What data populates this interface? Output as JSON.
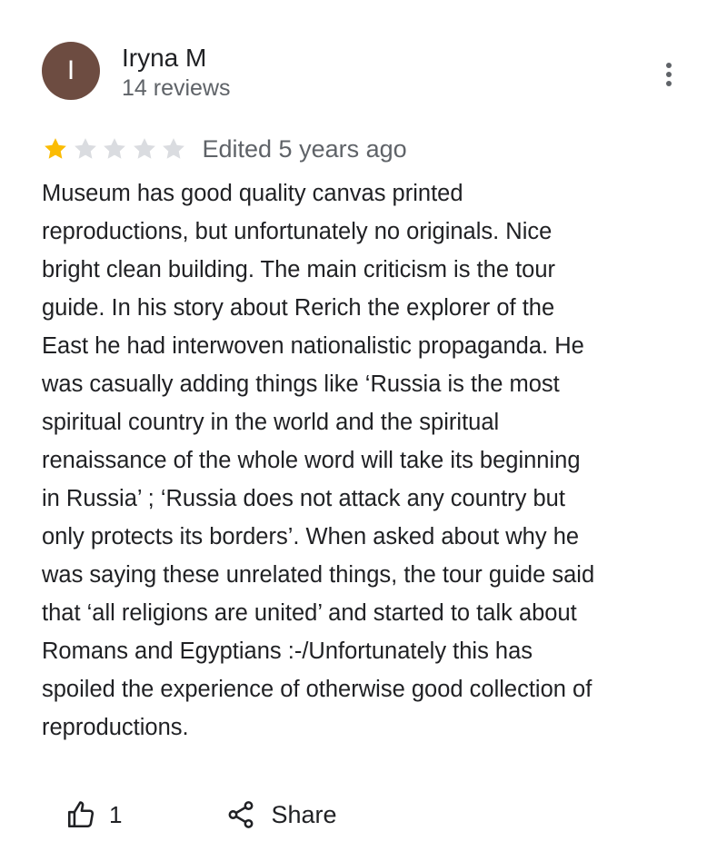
{
  "reviewer": {
    "initial": "I",
    "name": "Iryna M",
    "reviews": "14 reviews",
    "avatar_color": "#6d4c41"
  },
  "menu": {
    "icon": "more-vert-icon"
  },
  "rating": {
    "stars": 1,
    "max": 5,
    "filled_color": "#fbbc04",
    "empty_color": "#dadce0",
    "edited": "Edited 5 years ago"
  },
  "review": {
    "text": "Museum has good quality canvas printed\nreproductions, but unfortunately no originals. Nice\nbright clean building. The main criticism is the tour\nguide. In his story about Rerich the explorer of the\nEast he had interwoven nationalistic propaganda. He\nwas casually adding things like ‘Russia is the most\nspiritual country in the world and the spiritual\nrenaissance of the whole word will take its beginning\nin Russia’ ; ‘Russia  does not attack any country but\nonly protects its borders’. When asked about why he\nwas saying these unrelated things, the tour guide said\nthat ‘all religions are united’ and started to talk about\nRomans and Egyptians :-/Unfortunately this has\nspoiled the experience of otherwise good collection of\nreproductions."
  },
  "actions": {
    "like_count": "1",
    "like_icon": "thumb-up-icon",
    "share_label": "Share",
    "share_icon": "share-icon"
  }
}
